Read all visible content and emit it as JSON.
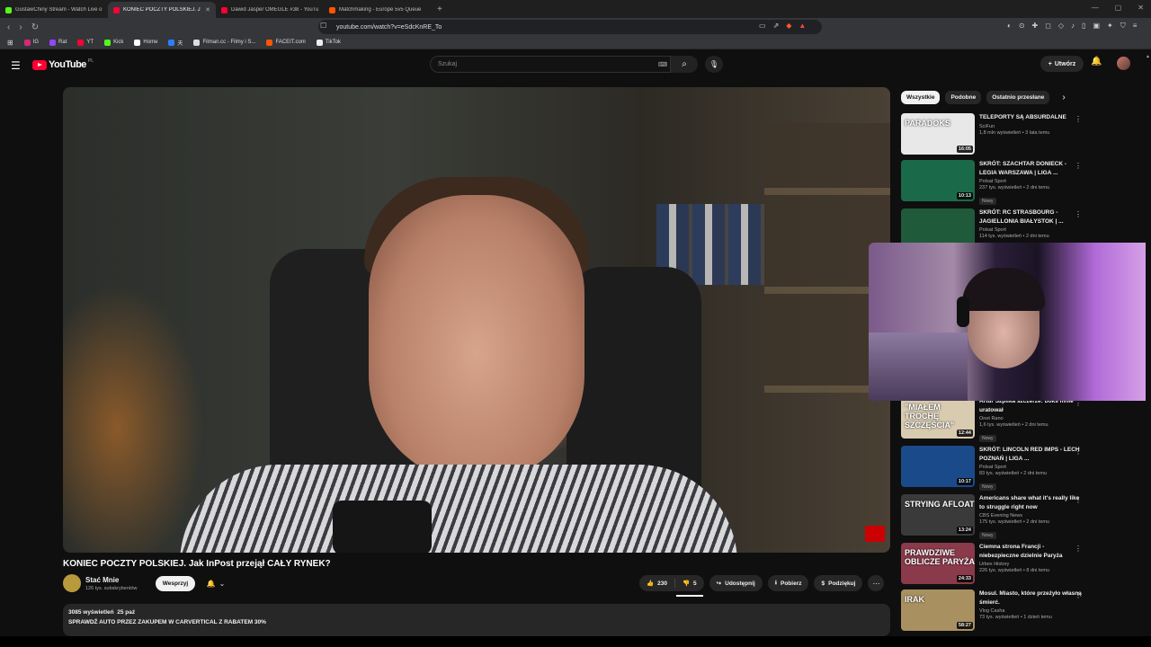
{
  "browser": {
    "tabs": [
      {
        "title": "GustawChiny Stream - Watch Live o",
        "color": "#53fc18",
        "active": false
      },
      {
        "title": "KONIEC POCZTY POLSKIEJ. J",
        "color": "#ff0033",
        "active": true
      },
      {
        "title": "Dawid Jasper OMEGLE #38 - YouTub",
        "color": "#ff0033",
        "active": false
      },
      {
        "title": "Matchmaking - Europe 5v5 Queue",
        "color": "#ff5500",
        "active": false
      }
    ],
    "url": "youtube.com/watch?v=eSdcKnRE_To",
    "bookmarks": [
      {
        "label": "IG",
        "color": "#d62976"
      },
      {
        "label": "Rat",
        "color": "#9146ff"
      },
      {
        "label": "YT",
        "color": "#ff0033"
      },
      {
        "label": "Kick",
        "color": "#53fc18"
      },
      {
        "label": "Home",
        "color": "#ffffff"
      },
      {
        "label": "天",
        "color": "#2b7fff"
      },
      {
        "label": "Filman.cc - Filmy i S...",
        "color": "#ffffff"
      },
      {
        "label": "FACEIT.com",
        "color": "#ff5500"
      },
      {
        "label": "TikTok",
        "color": "#ffffff"
      }
    ]
  },
  "header": {
    "logo": "YouTube",
    "logo_region": "PL",
    "search_placeholder": "Szukaj",
    "create_label": "Utwórz"
  },
  "video": {
    "title": "KONIEC POCZTY POLSKIEJ. Jak InPost przejął CAŁY RYNEK?",
    "channel": "Stać Mnie",
    "subscribers": "126 tys. subskrybentów",
    "support_label": "Wesprzyj",
    "likes": "230",
    "dislikes": "5",
    "share_label": "Udostępnij",
    "download_label": "Pobierz",
    "thanks_label": "Podziękuj",
    "views": "3085 wyświetleń",
    "date": "25 paź",
    "description_line": "SPRAWDŹ AUTO PRZEZ ZAKUPEM W CARVERTICAL Z RABATEM 30%"
  },
  "sidebar": {
    "chips": [
      "Wszystkie",
      "Podobne",
      "Ostatnio przesłane"
    ],
    "recommendations": [
      {
        "title": "TELEPORTY SĄ ABSURDALNE",
        "channel": "SciFun",
        "meta": "1,8 mln wyświetleń • 3 lata temu",
        "duration": "16:05",
        "badge": "",
        "thumb_text": "PARADOKS",
        "thumb_bg": "#e8e8e8"
      },
      {
        "title": "SKRÓT: SZACHTAR DONIECK - LEGIA WARSZAWA | LIGA ...",
        "channel": "Polsat Sport",
        "meta": "237 tys. wyświetleń • 2 dni temu",
        "duration": "10:13",
        "badge": "Nowy",
        "thumb_text": "",
        "thumb_bg": "#1a6a4a"
      },
      {
        "title": "SKRÓT: RC STRASBOURG - JAGIELLONIA BIAŁYSTOK | ...",
        "channel": "Polsat Sport",
        "meta": "114 tys. wyświetleń • 2 dni temu",
        "duration": "",
        "badge": "",
        "thumb_text": "",
        "thumb_bg": "#1f5a3a"
      },
      {
        "title": "Artur Szpilka szczerze: boks mnie uratował",
        "channel": "Onet Rano",
        "meta": "1,6 tys. wyświetleń • 2 dni temu",
        "duration": "12:44",
        "badge": "Nowy",
        "thumb_text": "\"MIAŁEM TROCHĘ SZCZĘŚCIA\"",
        "thumb_bg": "#d8cbb0"
      },
      {
        "title": "SKRÓT: LINCOLN RED IMPS - LECH POZNAŃ | LIGA ...",
        "channel": "Polsat Sport",
        "meta": "83 tys. wyświetleń • 2 dni temu",
        "duration": "10:17",
        "badge": "Nowy",
        "thumb_text": "",
        "thumb_bg": "#1b4a8a"
      },
      {
        "title": "Americans share what it's really like to struggle right now",
        "channel": "CBS Evening News",
        "meta": "175 tys. wyświetleń • 2 dni temu",
        "duration": "13:24",
        "badge": "Nowy",
        "thumb_text": "STRYING AFLOAT",
        "thumb_bg": "#3a3a3a"
      },
      {
        "title": "Ciemna strona Francji - niebezpieczne dzielnie Paryża",
        "channel": "Urbex History",
        "meta": "226 tys. wyświetleń • 8 dni temu",
        "duration": "24:33",
        "badge": "",
        "thumb_text": "PRAWDZIWE OBLICZE PARYŻA",
        "thumb_bg": "#8a3a4a"
      },
      {
        "title": "Mosul. Miasto, które przeżyło własną śmierć.",
        "channel": "Vlog Casha",
        "meta": "73 tys. wyświetleń • 1 dzień temu",
        "duration": "58:27",
        "badge": "",
        "thumb_text": "IRAK",
        "thumb_bg": "#a89060"
      }
    ]
  }
}
